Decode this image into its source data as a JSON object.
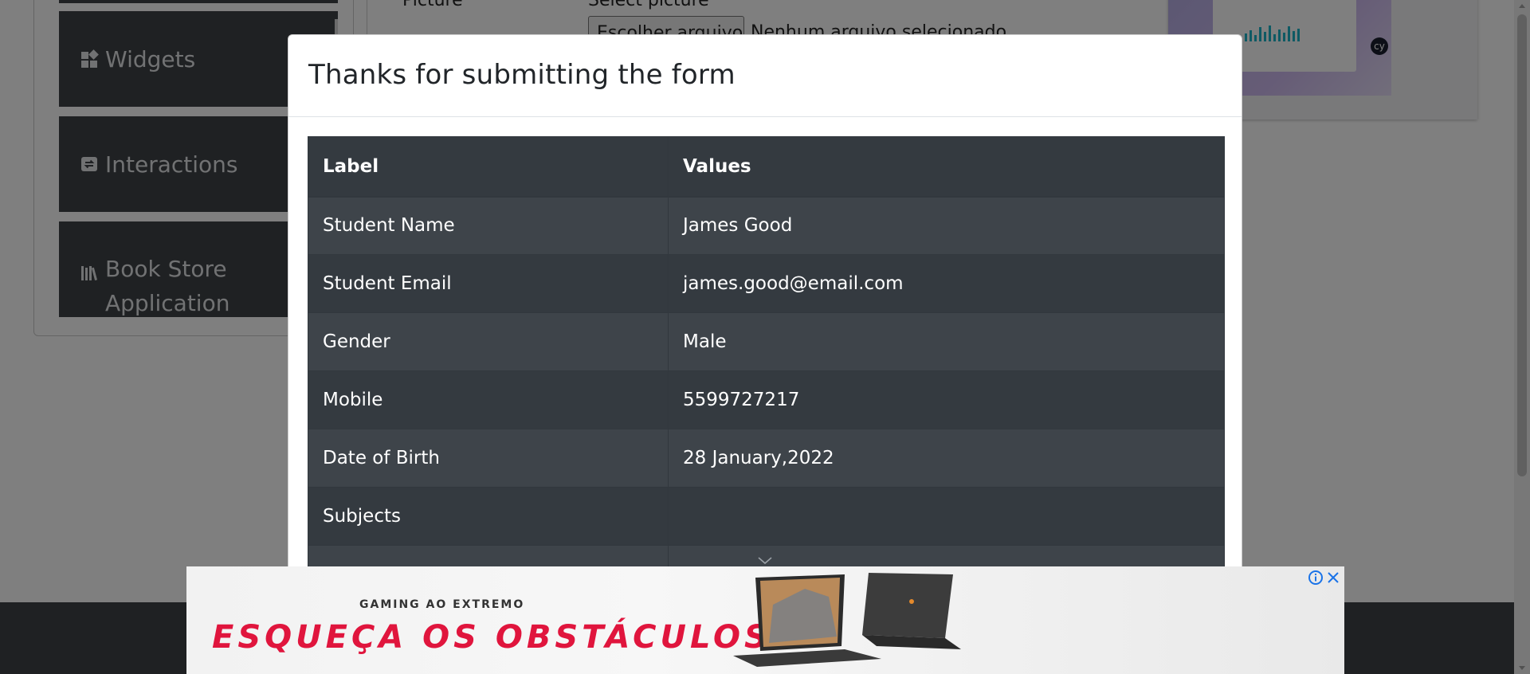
{
  "sidebar": {
    "items": [
      {
        "label": "Widgets",
        "icon": "widgets-icon"
      },
      {
        "label": "Interactions",
        "icon": "interactions-icon"
      },
      {
        "label": "Book Store Application",
        "icon": "book-store-icon"
      }
    ]
  },
  "form_bg": {
    "picture_label": "Picture",
    "select_picture": "Select picture",
    "file_button": "Escolher arquivo",
    "file_status": "Nenhum arquivo selecionado"
  },
  "modal": {
    "title": "Thanks for submitting the form",
    "table": {
      "headers": [
        "Label",
        "Values"
      ],
      "rows": [
        {
          "label": "Student Name",
          "value": "James Good"
        },
        {
          "label": "Student Email",
          "value": "james.good@email.com"
        },
        {
          "label": "Gender",
          "value": "Male"
        },
        {
          "label": "Mobile",
          "value": "5599727217"
        },
        {
          "label": "Date of Birth",
          "value": "28 January,2022"
        },
        {
          "label": "Subjects",
          "value": ""
        }
      ]
    }
  },
  "ad": {
    "kicker": "GAMING AO EXTREMO",
    "headline": "ESQUEÇA OS OBSTÁCULOS",
    "accent_color": "#e0153d"
  },
  "colors": {
    "sidebar_bg": "#3f4247",
    "table_dark": "#343a40",
    "table_stripe": "#3e444a",
    "backdrop": "rgba(0,0,0,0.5)"
  }
}
